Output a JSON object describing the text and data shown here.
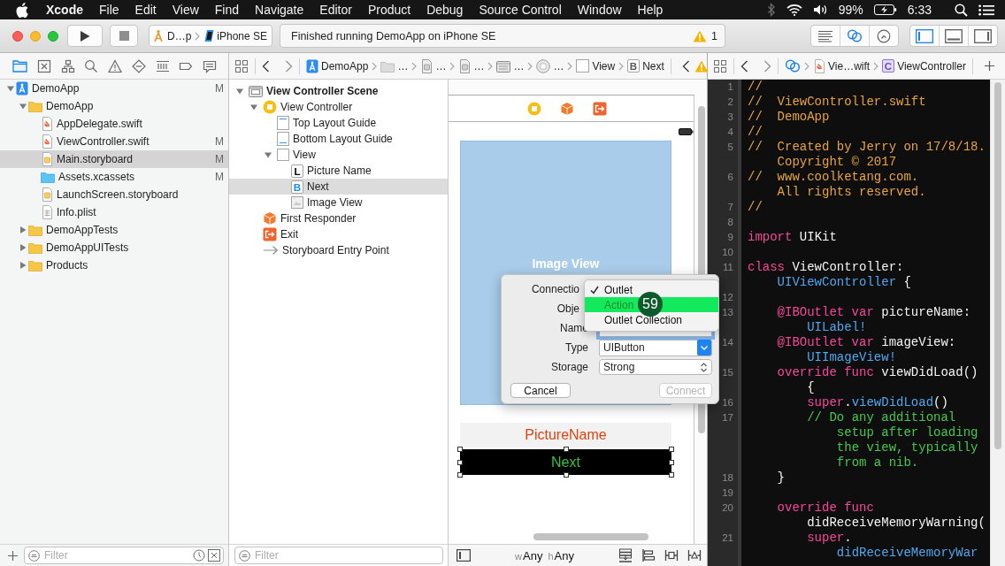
{
  "menu_bar": {
    "app_name": "Xcode",
    "menus": [
      "File",
      "Edit",
      "View",
      "Find",
      "Navigate",
      "Editor",
      "Product",
      "Debug",
      "Source Control",
      "Window",
      "Help"
    ],
    "battery": "99%",
    "clock": "6:33"
  },
  "toolbar": {
    "scheme": "D…p",
    "destination": "iPhone SE",
    "activity": "Finished running DemoApp on iPhone SE",
    "warning_count": "1",
    "editor_modes": [
      {
        "kind": "standard",
        "selected": false
      },
      {
        "kind": "assistant",
        "selected": true
      },
      {
        "kind": "version",
        "selected": false
      }
    ],
    "panels": [
      {
        "kind": "navigator",
        "on": true
      },
      {
        "kind": "debug",
        "on": false
      },
      {
        "kind": "utilities",
        "on": false
      }
    ]
  },
  "navigator_tabs": [
    {
      "kind": "project",
      "selected": true
    },
    {
      "kind": "source_control",
      "selected": false
    },
    {
      "kind": "symbol",
      "selected": false
    },
    {
      "kind": "find",
      "selected": false
    },
    {
      "kind": "issue",
      "selected": false
    },
    {
      "kind": "test",
      "selected": false
    },
    {
      "kind": "debug",
      "selected": false
    },
    {
      "kind": "breakpoint",
      "selected": false
    },
    {
      "kind": "report",
      "selected": false
    }
  ],
  "project_navigator": {
    "items": [
      {
        "label": "DemoApp",
        "kind": "project",
        "expanded": true,
        "selected": false,
        "status": "M",
        "children": [
          {
            "label": "DemoApp",
            "kind": "folder",
            "expanded": true,
            "selected": false,
            "children": [
              {
                "label": "AppDelegate.swift",
                "kind": "swift",
                "selected": false
              },
              {
                "label": "ViewController.swift",
                "kind": "swift",
                "selected": false,
                "status": "M"
              },
              {
                "label": "Main.storyboard",
                "kind": "storyboard",
                "selected": true,
                "status": "M"
              },
              {
                "label": "Assets.xcassets",
                "kind": "assets",
                "selected": false,
                "status": "M"
              },
              {
                "label": "LaunchScreen.storyboard",
                "kind": "storyboard",
                "selected": false
              },
              {
                "label": "Info.plist",
                "kind": "plist",
                "selected": false
              }
            ]
          },
          {
            "label": "DemoAppTests",
            "kind": "folder",
            "expanded": false,
            "selected": false
          },
          {
            "label": "DemoAppUITests",
            "kind": "folder",
            "expanded": false,
            "selected": false
          },
          {
            "label": "Products",
            "kind": "folder",
            "expanded": false,
            "selected": false
          }
        ]
      }
    ],
    "filter_placeholder": "Filter"
  },
  "editor_jump_bar": {
    "path": [
      {
        "kind": "project",
        "label": "DemoApp"
      },
      {
        "kind": "folder",
        "label": "…"
      },
      {
        "kind": "storyboard",
        "label": "…"
      },
      {
        "kind": "storyboard",
        "label": "…"
      },
      {
        "kind": "scene",
        "label": "…"
      },
      {
        "kind": "controller",
        "label": "…"
      },
      {
        "kind": "view",
        "label": "View"
      },
      {
        "kind": "letter",
        "icon_letter": "B",
        "label": "Next"
      }
    ]
  },
  "document_outline": {
    "items": [
      {
        "label": "View Controller Scene",
        "kind": "scene",
        "expanded": true,
        "selected": false,
        "children": [
          {
            "label": "View Controller",
            "kind": "controller",
            "expanded": true,
            "selected": false,
            "children": [
              {
                "label": "Top Layout Guide",
                "kind": "top_guide",
                "selected": false
              },
              {
                "label": "Bottom Layout Guide",
                "kind": "bottom_guide",
                "selected": false
              },
              {
                "label": "View",
                "kind": "view",
                "expanded": true,
                "selected": false,
                "children": [
                  {
                    "label": "Picture Name",
                    "kind": "letter",
                    "icon_letter": "L",
                    "color": "#000000",
                    "selected": false
                  },
                  {
                    "label": "Next",
                    "kind": "letter",
                    "icon_letter": "B",
                    "color": "#1a8cf0",
                    "selected": true
                  },
                  {
                    "label": "Image View",
                    "kind": "image",
                    "selected": false
                  }
                ]
              }
            ]
          },
          {
            "label": "First Responder",
            "kind": "first_responder",
            "selected": false
          },
          {
            "label": "Exit",
            "kind": "exit",
            "selected": false
          },
          {
            "label": "Storyboard Entry Point",
            "kind": "entry_point",
            "selected": false
          }
        ]
      }
    ],
    "filter_placeholder": "Filter"
  },
  "canvas": {
    "image_view_label": "Image View",
    "label_text": "PictureName",
    "button_title": "Next",
    "button_selected": true,
    "size_classes": [
      {
        "axis": "w",
        "value": "Any"
      },
      {
        "axis": "h",
        "value": "Any"
      }
    ]
  },
  "connection_dialog": {
    "rows": [
      {
        "kind": "menu",
        "label": "Connectio"
      },
      {
        "kind": "covered",
        "label": "Obje"
      },
      {
        "kind": "text",
        "label": "Name",
        "focused": true
      },
      {
        "kind": "combo",
        "label": "Type",
        "value": "UIButton"
      },
      {
        "kind": "popup",
        "label": "Storage",
        "value": "Strong"
      }
    ],
    "buttons": [
      {
        "label": "Cancel",
        "disabled": false
      },
      {
        "label": "Connect",
        "disabled": true
      }
    ],
    "menu": [
      {
        "label": "Outlet",
        "checked": true,
        "selected": false
      },
      {
        "label": "Action",
        "checked": false,
        "selected": true
      },
      {
        "label": "Outlet Collection",
        "checked": false,
        "selected": false
      }
    ],
    "step_badge": "59"
  },
  "code_jump_bar": {
    "file": "Vie…wift",
    "symbol_letter": "C",
    "symbol": "ViewController"
  },
  "code_editor": {
    "lines": [
      {
        "number": "1",
        "rows": [
          {
            "segments": [
              {
                "kind": "header",
                "text": "//"
              }
            ]
          }
        ]
      },
      {
        "number": "2",
        "rows": [
          {
            "segments": [
              {
                "kind": "header",
                "text": "//  ViewController.swift"
              }
            ]
          }
        ]
      },
      {
        "number": "3",
        "rows": [
          {
            "segments": [
              {
                "kind": "header",
                "text": "//  DemoApp"
              }
            ]
          }
        ]
      },
      {
        "number": "4",
        "rows": [
          {
            "segments": [
              {
                "kind": "header",
                "text": "//"
              }
            ]
          }
        ]
      },
      {
        "number": "5",
        "rows": [
          {
            "segments": [
              {
                "kind": "header",
                "text": "//  Created by Jerry on 17/8/18."
              }
            ]
          },
          {
            "segments": [
              {
                "kind": "header",
                "text": "    Copyright © 2017"
              }
            ]
          }
        ]
      },
      {
        "number": "6",
        "rows": [
          {
            "segments": [
              {
                "kind": "header",
                "text": "//  www.coolketang.com."
              }
            ]
          },
          {
            "segments": [
              {
                "kind": "header",
                "text": "    All rights reserved."
              }
            ]
          }
        ]
      },
      {
        "number": "7",
        "rows": [
          {
            "segments": [
              {
                "kind": "header",
                "text": "//"
              }
            ]
          }
        ]
      },
      {
        "number": "8"
      },
      {
        "number": "9",
        "rows": [
          {
            "segments": [
              {
                "kind": "keyword",
                "text": "import"
              },
              {
                "kind": "plain",
                "text": " UIKit"
              }
            ]
          }
        ]
      },
      {
        "number": "10"
      },
      {
        "number": "11",
        "rows": [
          {
            "segments": [
              {
                "kind": "keyword",
                "text": "class"
              },
              {
                "kind": "plain",
                "text": " ViewController:"
              }
            ]
          },
          {
            "segments": [
              {
                "kind": "api",
                "text": "    UIViewController"
              },
              {
                "kind": "plain",
                "text": " {"
              }
            ]
          }
        ]
      },
      {
        "number": "12"
      },
      {
        "number": "13",
        "rows": [
          {
            "segments": [
              {
                "kind": "keyword",
                "text": "    @IBOutlet var"
              },
              {
                "kind": "plain",
                "text": " pictureName:"
              }
            ]
          },
          {
            "segments": [
              {
                "kind": "api",
                "text": "        UILabel!"
              }
            ]
          }
        ]
      },
      {
        "number": "14",
        "rows": [
          {
            "segments": [
              {
                "kind": "keyword",
                "text": "    @IBOutlet var"
              },
              {
                "kind": "plain",
                "text": " imageView:"
              }
            ]
          },
          {
            "segments": [
              {
                "kind": "api",
                "text": "        UIImageView!"
              }
            ]
          }
        ]
      },
      {
        "number": "15",
        "rows": [
          {
            "segments": [
              {
                "kind": "keyword",
                "text": "    override func"
              },
              {
                "kind": "plain",
                "text": " viewDidLoad()"
              }
            ]
          },
          {
            "segments": [
              {
                "kind": "plain",
                "text": "        {"
              }
            ]
          }
        ]
      },
      {
        "number": "16",
        "rows": [
          {
            "segments": [
              {
                "kind": "keyword",
                "text": "        super"
              },
              {
                "kind": "plain",
                "text": "."
              },
              {
                "kind": "api",
                "text": "viewDidLoad"
              },
              {
                "kind": "plain",
                "text": "()"
              }
            ]
          }
        ]
      },
      {
        "number": "17",
        "rows": [
          {
            "segments": [
              {
                "kind": "comment",
                "text": "        // Do any additional"
              }
            ]
          },
          {
            "segments": [
              {
                "kind": "comment",
                "text": "            setup after loading"
              }
            ]
          },
          {
            "segments": [
              {
                "kind": "comment",
                "text": "            the view, typically"
              }
            ]
          },
          {
            "segments": [
              {
                "kind": "comment",
                "text": "            from a nib."
              }
            ]
          }
        ]
      },
      {
        "number": "18",
        "rows": [
          {
            "segments": [
              {
                "kind": "plain",
                "text": "    }"
              }
            ]
          }
        ]
      },
      {
        "number": "19"
      },
      {
        "number": "20",
        "rows": [
          {
            "segments": [
              {
                "kind": "keyword",
                "text": "    override func"
              }
            ]
          },
          {
            "segments": [
              {
                "kind": "plain",
                "text": "        didReceiveMemoryWarning("
              }
            ]
          }
        ]
      },
      {
        "number": "21",
        "rows": [
          {
            "segments": [
              {
                "kind": "keyword",
                "text": "        super"
              },
              {
                "kind": "plain",
                "text": "."
              }
            ]
          },
          {
            "segments": [
              {
                "kind": "api",
                "text": "            didReceiveMemoryWar"
              }
            ]
          }
        ]
      }
    ]
  }
}
